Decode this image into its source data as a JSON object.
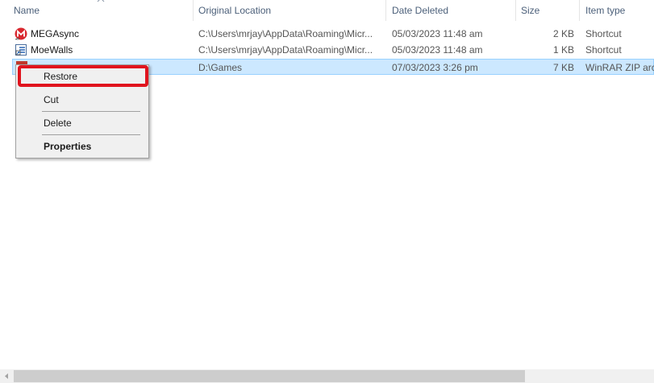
{
  "columns": {
    "name": "Name",
    "original_location": "Original Location",
    "date_deleted": "Date Deleted",
    "size": "Size",
    "item_type": "Item type"
  },
  "rows": [
    {
      "name": "MEGAsync",
      "original_location": "C:\\Users\\mrjay\\AppData\\Roaming\\Micr...",
      "date_deleted": "05/03/2023 11:48 am",
      "size": "2 KB",
      "item_type": "Shortcut",
      "icon": "megasync-icon"
    },
    {
      "name": "MoeWalls",
      "original_location": "C:\\Users\\mrjay\\AppData\\Roaming\\Micr...",
      "date_deleted": "05/03/2023 11:48 am",
      "size": "1 KB",
      "item_type": "Shortcut",
      "icon": "shortcut-icon"
    },
    {
      "name": "",
      "original_location": "D:\\Games",
      "date_deleted": "07/03/2023 3:26 pm",
      "size": "7 KB",
      "item_type": "WinRAR ZIP archive",
      "icon": "winrar-zip-icon",
      "selected": true
    }
  ],
  "context_menu": {
    "restore": "Restore",
    "cut": "Cut",
    "delete": "Delete",
    "properties": "Properties"
  },
  "colors": {
    "header_text": "#4c607a",
    "selection_bg": "#cce8ff",
    "selection_border": "#99d1ff",
    "highlight_border": "#e0141e",
    "menu_bg": "#f0f0f0"
  }
}
